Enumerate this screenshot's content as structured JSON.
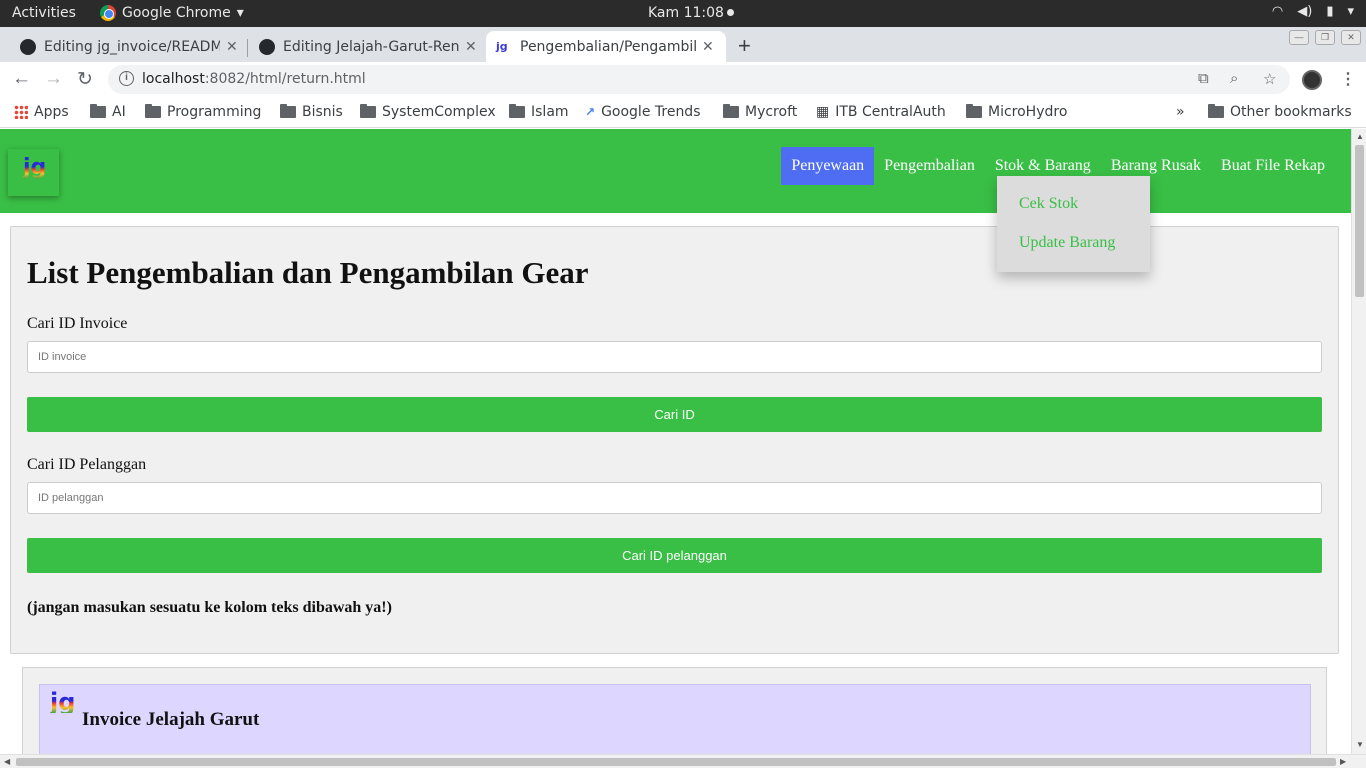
{
  "os": {
    "activities": "Activities",
    "app_name": "Google Chrome",
    "clock": "Kam 11:08"
  },
  "tabs": [
    {
      "title": "Editing jg_invoice/README",
      "icon": "github-icon"
    },
    {
      "title": "Editing Jelajah-Garut-Ren",
      "icon": "github-icon"
    },
    {
      "title": "Pengembalian/Pengambil",
      "icon": "jg-favicon",
      "active": true
    }
  ],
  "omnibox": {
    "host": "localhost",
    "rest": ":8082/html/return.html"
  },
  "bookmarks": {
    "items": [
      "Apps",
      "AI",
      "Programming",
      "Bisnis",
      "SystemComplex",
      "Islam",
      "Google Trends",
      "Mycroft",
      "ITB CentralAuth",
      "MicroHydro"
    ],
    "overflow": "»",
    "other": "Other bookmarks"
  },
  "site": {
    "logo": "jg",
    "nav": [
      {
        "label": "Penyewaan",
        "active": true
      },
      {
        "label": "Pengembalian"
      },
      {
        "label": "Stok & Barang"
      },
      {
        "label": "Barang Rusak"
      },
      {
        "label": "Buat File Rekap"
      }
    ],
    "dropdown": [
      "Cek Stok",
      "Update Barang"
    ],
    "accent_green": "#39bf45",
    "active_blue": "#4f6df2"
  },
  "main": {
    "heading": "List Pengembalian dan Pengambilan Gear",
    "invoice_label": "Cari ID Invoice",
    "invoice_placeholder": "ID invoice",
    "invoice_button": "Cari ID",
    "customer_label": "Cari ID Pelanggan",
    "customer_placeholder": "ID pelanggan",
    "customer_button": "Cari ID pelanggan",
    "warning": "(jangan masukan sesuatu ke kolom teks dibawah ya!)"
  },
  "invoice": {
    "logo": "jg",
    "title": "Invoice Jelajah Garut"
  }
}
